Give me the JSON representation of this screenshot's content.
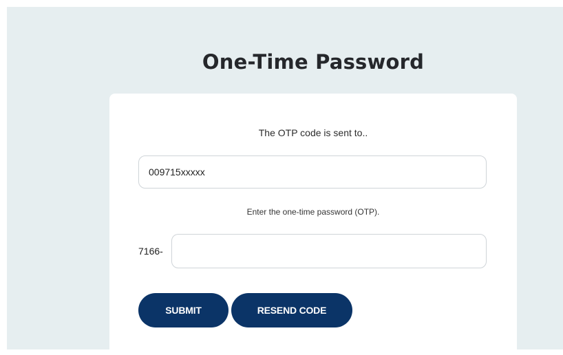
{
  "page": {
    "title": "One-Time Password"
  },
  "form": {
    "sent_text": "The OTP code is sent to..",
    "phone_value": "009715xxxxx",
    "otp_hint": "Enter the one-time password (OTP).",
    "otp_prefix": "7166-",
    "otp_value": "",
    "submit_label": "SUBMIT",
    "resend_label": "RESEND CODE"
  },
  "colors": {
    "page_background": "#e6eef0",
    "card_background": "#ffffff",
    "button_background": "#0b3467",
    "button_text": "#ffffff",
    "field_border": "#cfd4d8"
  }
}
